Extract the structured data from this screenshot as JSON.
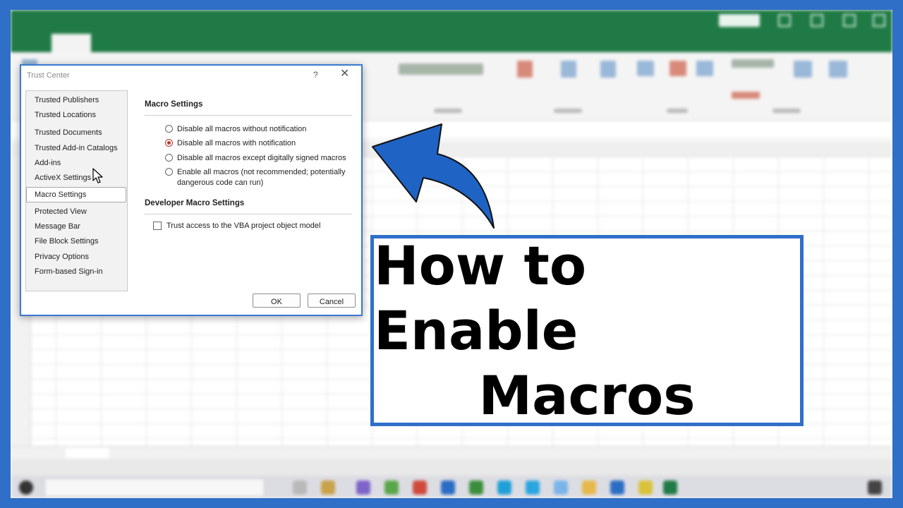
{
  "dialog": {
    "title": "Trust Center",
    "help_glyph": "?",
    "close_glyph": "✕",
    "nav_items": [
      {
        "label": "Trusted Publishers",
        "selected": false
      },
      {
        "label": "Trusted Locations",
        "selected": false
      },
      {
        "label": "Trusted Documents",
        "selected": false
      },
      {
        "label": "Trusted Add-in Catalogs",
        "selected": false
      },
      {
        "label": "Add-ins",
        "selected": false
      },
      {
        "label": "ActiveX Settings",
        "selected": false
      },
      {
        "label": "Macro Settings",
        "selected": true
      },
      {
        "label": "Protected View",
        "selected": false
      },
      {
        "label": "Message Bar",
        "selected": false
      },
      {
        "label": "File Block Settings",
        "selected": false
      },
      {
        "label": "Privacy Options",
        "selected": false
      },
      {
        "label": "Form-based Sign-in",
        "selected": false
      }
    ],
    "macro_settings": {
      "heading": "Macro Settings",
      "options": [
        {
          "label": "Disable all macros without notification",
          "checked": false
        },
        {
          "label": "Disable all macros with notification",
          "checked": true
        },
        {
          "label": "Disable all macros except digitally signed macros",
          "checked": false
        },
        {
          "label": "Enable all macros (not recommended; potentially dangerous code can run)",
          "checked": false
        }
      ]
    },
    "developer_settings": {
      "heading": "Developer Macro Settings",
      "checkbox_label": "Trust access to the VBA project object model",
      "checked": false
    },
    "buttons": {
      "ok": "OK",
      "cancel": "Cancel"
    }
  },
  "title_card": {
    "line1": "How to Enable",
    "line2": "Macros"
  },
  "colors": {
    "frame_blue": "#2f6fc8",
    "excel_green": "#1f7a45",
    "checked_radio": "#c0392b"
  },
  "icons": [
    "mouse-cursor-icon",
    "curved-arrow-icon",
    "close-icon",
    "help-icon"
  ]
}
